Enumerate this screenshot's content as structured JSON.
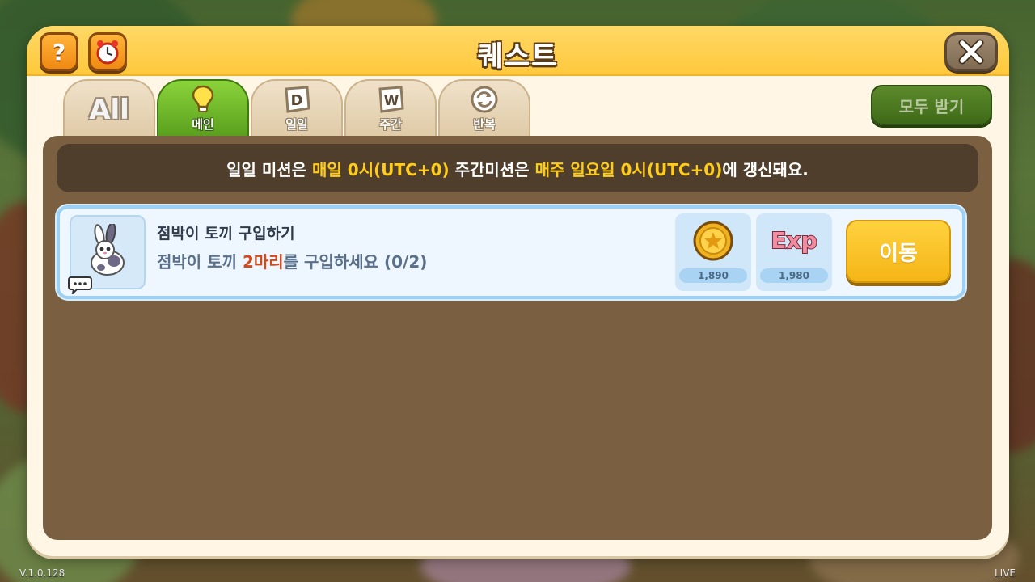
{
  "modal": {
    "title": "퀘스트",
    "help_label": "?",
    "claim_all_label": "모두 받기"
  },
  "tabs": [
    {
      "label": "",
      "icon": "all-text-icon",
      "text": "All",
      "active": false
    },
    {
      "label": "메인",
      "icon": "lightbulb-icon",
      "active": true
    },
    {
      "label": "일일",
      "icon": "daily-d-icon",
      "glyph": "D",
      "active": false
    },
    {
      "label": "주간",
      "icon": "weekly-w-icon",
      "glyph": "W",
      "active": false
    },
    {
      "label": "반복",
      "icon": "repeat-icon",
      "active": false
    }
  ],
  "notice": {
    "part1": "일일 미션은 ",
    "hl1": "매일 0시(UTC+0)",
    "part2": " 주간미션은 ",
    "hl2": "매주 일요일 0시(UTC+0)",
    "part3": "에 갱신돼요."
  },
  "quests": [
    {
      "title": "점박이 토끼 구입하기",
      "desc_prefix": "점박이 토끼 ",
      "desc_qty": "2마리",
      "desc_suffix": "를 구입하세요 (0/2)",
      "icon": "spotted-rabbit-icon",
      "rewards": [
        {
          "type": "coin",
          "icon": "gold-coin-icon",
          "value": "1,890"
        },
        {
          "type": "exp",
          "icon": "exp-icon",
          "text": "Exp",
          "value": "1,980"
        }
      ],
      "action_label": "이동"
    }
  ],
  "footer": {
    "version": "V.1.0.128",
    "live": "LIVE"
  },
  "colors": {
    "header": "#ffc93d",
    "active_tab": "#5aa01e",
    "panel": "#7a5f40",
    "highlight": "#ffcc1a",
    "go_button": "#f5b516"
  }
}
